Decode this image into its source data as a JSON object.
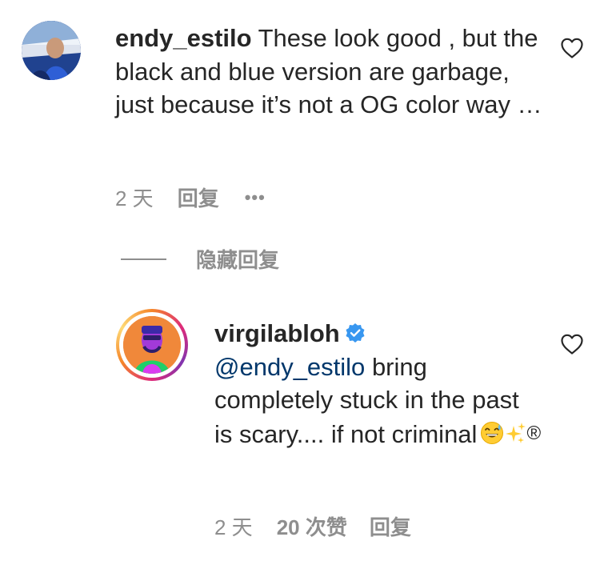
{
  "comment1": {
    "username": "endy_estilo",
    "text": "These look good , but the black and blue version are garbage, just because it’s not a OG color way …",
    "time": "2 天",
    "reply_label": "回复",
    "more_label": "•••",
    "avatar_icon": "user-avatar"
  },
  "hide_replies_label": "隐藏回复",
  "reply1": {
    "username": "virgilabloh",
    "verified_icon": "verified-badge-icon",
    "mention": "@endy_estilo",
    "text": "bring completely stuck in the past is scary.... if not criminal",
    "emoji": [
      "😅",
      "✨"
    ],
    "trailing_symbol": "®",
    "time": "2 天",
    "likes": "20 次赞",
    "reply_label": "回复",
    "avatar_icon": "user-avatar-story-ring"
  },
  "colors": {
    "text": "#262626",
    "secondary": "#8e8e8e",
    "mention": "#00376b",
    "verified": "#3897f0"
  }
}
